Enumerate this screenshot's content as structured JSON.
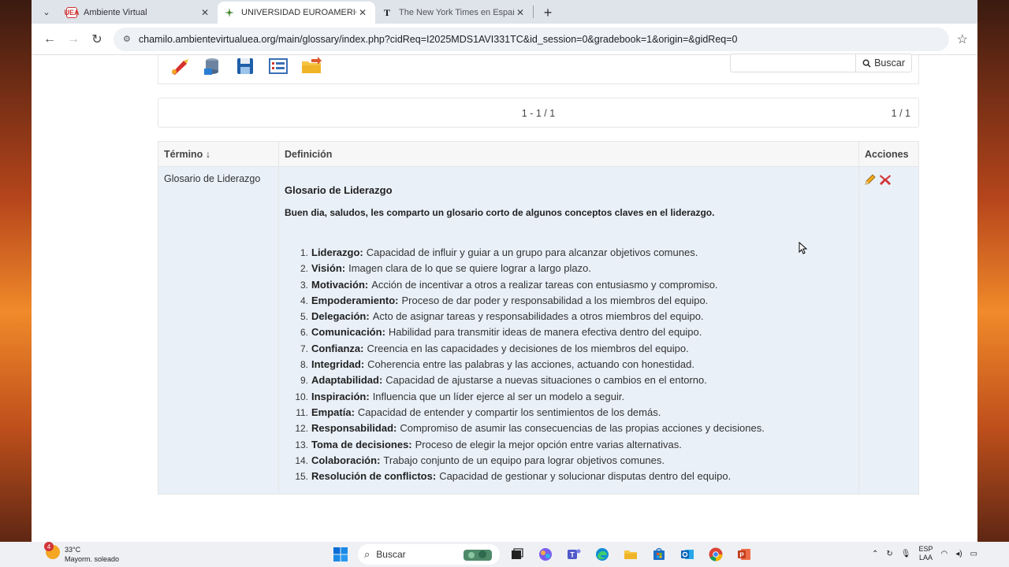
{
  "browser": {
    "tabs": [
      {
        "title": "Ambiente Virtual",
        "favicon": "UEA",
        "active": false
      },
      {
        "title": "UNIVERSIDAD EUROAMERICANA",
        "favicon": "",
        "active": true
      },
      {
        "title": "The New York Times en Español",
        "favicon": "T",
        "active": false
      }
    ],
    "url": "chamilo.ambientevirtualuea.org/main/glossary/index.php?cidReq=I2025MDS1AVI331TC&id_session=0&gradebook=1&origin=&gidReq=0"
  },
  "toolbar": {
    "search_label": "Buscar",
    "icons": [
      "add-term-icon",
      "import-icon",
      "export-icon",
      "list-view-icon",
      "export-folder-icon"
    ]
  },
  "pager": {
    "range": "1 - 1 / 1",
    "pages": "1 / 1"
  },
  "table": {
    "headers": {
      "term": "Término ↓",
      "definition": "Definición",
      "actions": "Acciones"
    },
    "row": {
      "term": "Glosario de Liderazgo",
      "title": "Glosario de Liderazgo",
      "intro": "Buen dia, saludos, les comparto un glosario corto de algunos conceptos claves en el liderazgo.",
      "items": [
        {
          "num": "1.",
          "term": "Liderazgo:",
          "text": "Capacidad de influir y guiar a un grupo para alcanzar objetivos comunes."
        },
        {
          "num": "2.",
          "term": "Visión:",
          "text": "Imagen clara de lo que se quiere lograr a largo plazo."
        },
        {
          "num": "3.",
          "term": "Motivación:",
          "text": "Acción de incentivar a otros a realizar tareas con entusiasmo y compromiso."
        },
        {
          "num": "4.",
          "term": "Empoderamiento:",
          "text": "Proceso de dar poder y responsabilidad a los miembros del equipo."
        },
        {
          "num": "5.",
          "term": "Delegación:",
          "text": "Acto de asignar tareas y responsabilidades a otros miembros del equipo."
        },
        {
          "num": "6.",
          "term": "Comunicación:",
          "text": "Habilidad para transmitir ideas de manera efectiva dentro del equipo."
        },
        {
          "num": "7.",
          "term": "Confianza:",
          "text": "Creencia en las capacidades y decisiones de los miembros del equipo."
        },
        {
          "num": "8.",
          "term": "Integridad:",
          "text": "Coherencia entre las palabras y las acciones, actuando con honestidad."
        },
        {
          "num": "9.",
          "term": "Adaptabilidad:",
          "text": "Capacidad de ajustarse a nuevas situaciones o cambios en el entorno."
        },
        {
          "num": "10.",
          "term": "Inspiración:",
          "text": "Influencia que un líder ejerce al ser un modelo a seguir."
        },
        {
          "num": "11.",
          "term": "Empatía:",
          "text": "Capacidad de entender y compartir los sentimientos de los demás."
        },
        {
          "num": "12.",
          "term": "Responsabilidad:",
          "text": "Compromiso de asumir las consecuencias de las propias acciones y decisiones."
        },
        {
          "num": "13.",
          "term": "Toma de decisiones:",
          "text": "Proceso de elegir la mejor opción entre varias alternativas."
        },
        {
          "num": "14.",
          "term": "Colaboración:",
          "text": "Trabajo conjunto de un equipo para lograr objetivos comunes."
        },
        {
          "num": "15.",
          "term": "Resolución de conflictos:",
          "text": "Capacidad de gestionar y solucionar disputas dentro del equipo."
        }
      ]
    }
  },
  "taskbar": {
    "weather_badge": "4",
    "temperature": "33°C",
    "condition": "Mayorm. soleado",
    "search_label": "Buscar",
    "lang_top": "ESP",
    "lang_bottom": "LAA"
  },
  "colors": {
    "accent": "#1a73e8",
    "table_row_bg": "#e9f0f8",
    "header_bg": "#f7f7f7"
  }
}
